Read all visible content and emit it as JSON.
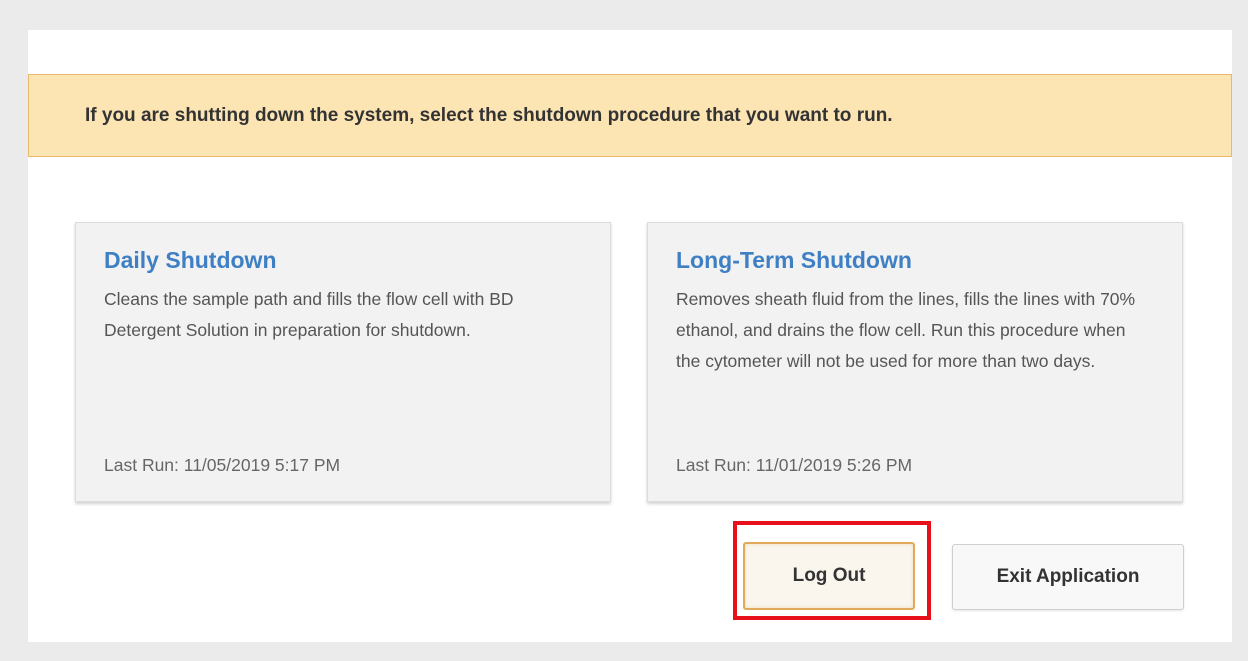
{
  "banner": {
    "message": "If you are shutting down the system, select the shutdown procedure that you want to run."
  },
  "cards": [
    {
      "title": "Daily Shutdown",
      "description": "Cleans the sample path and fills the flow cell with BD Detergent Solution in preparation for shutdown.",
      "last_run": "Last Run: 11/05/2019 5:17 PM"
    },
    {
      "title": "Long-Term Shutdown",
      "description": "Removes sheath fluid from the lines, fills the lines with 70% ethanol, and drains the flow cell. Run this procedure when the cytometer will not be used for more than two days.",
      "last_run": "Last Run: 11/01/2019 5:26 PM"
    }
  ],
  "buttons": {
    "logout_label": "Log Out",
    "exit_label": "Exit Application"
  },
  "colors": {
    "banner_bg": "#fce4b3",
    "title_blue": "#3f7fc4",
    "highlight_red": "#e8101a"
  }
}
